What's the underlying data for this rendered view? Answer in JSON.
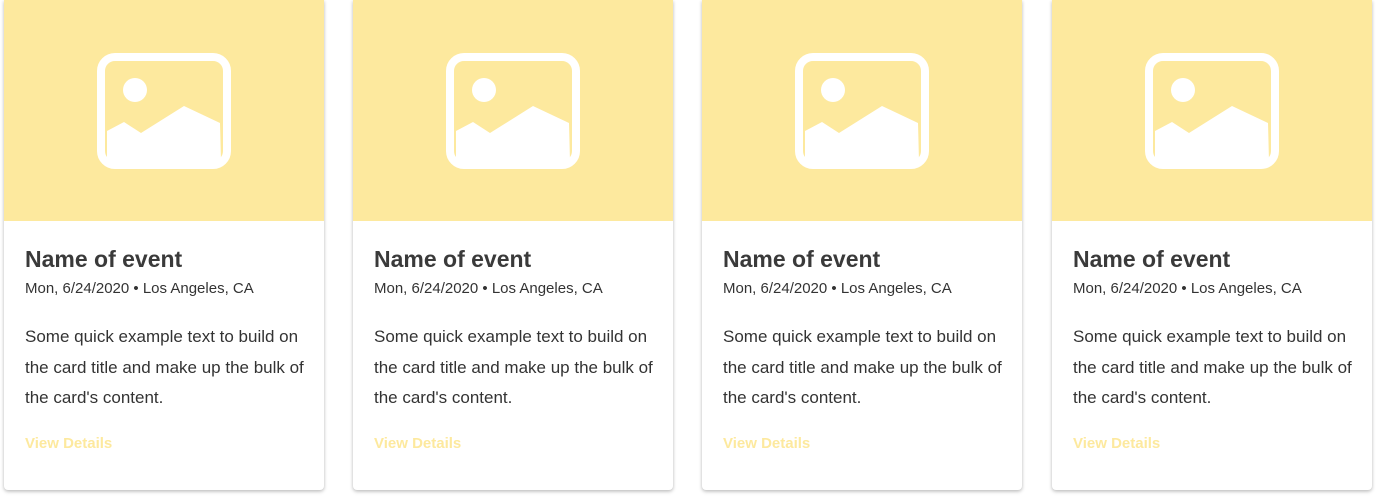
{
  "colors": {
    "image_bg": "#fde99e",
    "link": "#fde99e",
    "title": "#3a3a3a",
    "text": "#333333"
  },
  "cards": [
    {
      "image_icon": "image-placeholder-icon",
      "title": "Name of event",
      "meta": "Mon, 6/24/2020 • Los Angeles, CA",
      "text": "Some quick example text to build on the card title and make up the bulk of the card's content.",
      "link_label": "View Details"
    },
    {
      "image_icon": "image-placeholder-icon",
      "title": "Name of event",
      "meta": "Mon, 6/24/2020 • Los Angeles, CA",
      "text": "Some quick example text to build on the card title and make up the bulk of the card's content.",
      "link_label": "View Details"
    },
    {
      "image_icon": "image-placeholder-icon",
      "title": "Name of event",
      "meta": "Mon, 6/24/2020 • Los Angeles, CA",
      "text": "Some quick example text to build on the card title and make up the bulk of the card's content.",
      "link_label": "View Details"
    },
    {
      "image_icon": "image-placeholder-icon",
      "title": "Name of event",
      "meta": "Mon, 6/24/2020 • Los Angeles, CA",
      "text": "Some quick example text to build on the card title and make up the bulk of the card's content.",
      "link_label": "View Details"
    }
  ]
}
